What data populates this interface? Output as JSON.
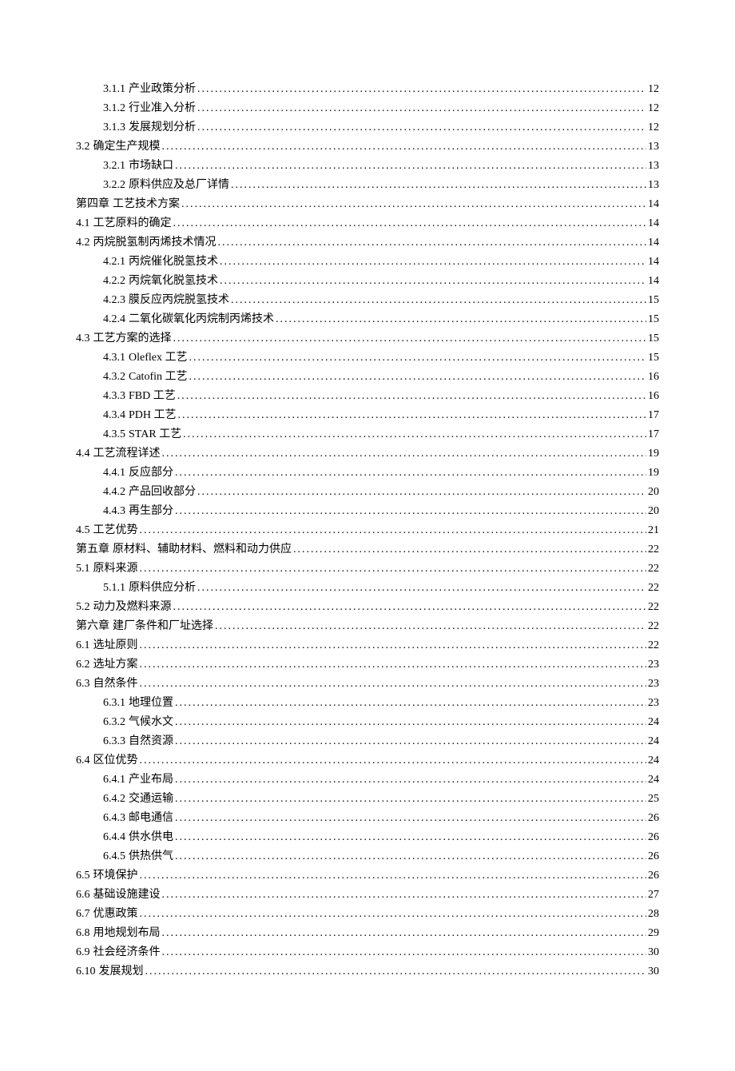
{
  "toc": [
    {
      "level": 3,
      "number": "3.1.1",
      "title": "产业政策分析",
      "page": "12"
    },
    {
      "level": 3,
      "number": "3.1.2",
      "title": "行业准入分析",
      "page": "12"
    },
    {
      "level": 3,
      "number": "3.1.3",
      "title": "发展规划分析",
      "page": "12"
    },
    {
      "level": 1,
      "number": "3.2",
      "title": "确定生产规模",
      "page": "13"
    },
    {
      "level": 2,
      "number": "3.2.1",
      "title": "市场缺口",
      "page": "13"
    },
    {
      "level": 2,
      "number": "3.2.2",
      "title": "原料供应及总厂详情",
      "page": "13"
    },
    {
      "level": 1,
      "number": "第四章",
      "title": "工艺技术方案",
      "page": "14"
    },
    {
      "level": 1,
      "number": "4.1",
      "title": "工艺原料的确定",
      "page": "14"
    },
    {
      "level": 1,
      "number": "4.2",
      "title": "丙烷脱氢制丙烯技术情况",
      "page": "14"
    },
    {
      "level": 3,
      "number": "4.2.1",
      "title": "丙烷催化脱氢技术",
      "page": "14"
    },
    {
      "level": 3,
      "number": "4.2.2",
      "title": "丙烷氧化脱氢技术",
      "page": "14"
    },
    {
      "level": 2,
      "number": "4.2.3",
      "title": "膜反应丙烷脱氢技术",
      "page": "15"
    },
    {
      "level": 2,
      "number": "4.2.4",
      "title": "二氧化碳氧化丙烷制丙烯技术",
      "page": "15"
    },
    {
      "level": 1,
      "number": "4.3",
      "title": "工艺方案的选择",
      "page": "15"
    },
    {
      "level": 2,
      "number": "4.3.1",
      "title": "Oleflex 工艺",
      "page": "15"
    },
    {
      "level": 2,
      "number": "4.3.2",
      "title": "Catofin 工艺",
      "page": "16"
    },
    {
      "level": 2,
      "number": "4.3.3",
      "title": "FBD 工艺",
      "page": "16"
    },
    {
      "level": 2,
      "number": "4.3.4",
      "title": "PDH 工艺",
      "page": "17"
    },
    {
      "level": 2,
      "number": "4.3.5",
      "title": "STAR 工艺",
      "page": "17"
    },
    {
      "level": 1,
      "number": "4.4",
      "title": "工艺流程详述",
      "page": "19"
    },
    {
      "level": 3,
      "number": "4.4.1",
      "title": "反应部分",
      "page": "19"
    },
    {
      "level": 3,
      "number": "4.4.2",
      "title": "产品回收部分",
      "page": "20"
    },
    {
      "level": 3,
      "number": "4.4.3",
      "title": "再生部分",
      "page": "20"
    },
    {
      "level": 1,
      "number": "4.5",
      "title": "工艺优势",
      "page": "21"
    },
    {
      "level": 1,
      "number": "第五章",
      "title": "原材料、辅助材料、燃料和动力供应",
      "page": "22"
    },
    {
      "level": 1,
      "number": "5.1",
      "title": "原料来源",
      "page": "22"
    },
    {
      "level": 2,
      "number": "5.1.1",
      "title": "原料供应分析",
      "page": "22"
    },
    {
      "level": 1,
      "number": "5.2",
      "title": "动力及燃料来源",
      "page": "22"
    },
    {
      "level": 1,
      "number": "第六章",
      "title": "建厂条件和厂址选择",
      "page": "22"
    },
    {
      "level": 1,
      "number": "6.1",
      "title": "选址原则",
      "page": "22"
    },
    {
      "level": 1,
      "number": "6.2",
      "title": "选址方案",
      "page": "23"
    },
    {
      "level": 1,
      "number": "6.3",
      "title": "自然条件",
      "page": "23"
    },
    {
      "level": 2,
      "number": "6.3.1",
      "title": "地理位置",
      "page": "23"
    },
    {
      "level": 2,
      "number": "6.3.2",
      "title": "气候水文",
      "page": "24"
    },
    {
      "level": 2,
      "number": "6.3.3",
      "title": "自然资源",
      "page": "24"
    },
    {
      "level": 1,
      "number": "6.4",
      "title": "区位优势",
      "page": "24"
    },
    {
      "level": 2,
      "number": "6.4.1",
      "title": "产业布局",
      "page": "24"
    },
    {
      "level": 2,
      "number": "6.4.2",
      "title": "交通运输",
      "page": "25"
    },
    {
      "level": 2,
      "number": "6.4.3",
      "title": "邮电通信",
      "page": "26"
    },
    {
      "level": 2,
      "number": "6.4.4",
      "title": "供水供电",
      "page": "26"
    },
    {
      "level": 2,
      "number": "6.4.5",
      "title": "供热供气",
      "page": "26"
    },
    {
      "level": 1,
      "number": "6.5",
      "title": "环境保护",
      "page": "26"
    },
    {
      "level": 1,
      "number": "6.6",
      "title": "基础设施建设",
      "page": "27"
    },
    {
      "level": 1,
      "number": "6.7",
      "title": "优惠政策",
      "page": "28"
    },
    {
      "level": 1,
      "number": "6.8",
      "title": "用地规划布局",
      "page": "29"
    },
    {
      "level": 1,
      "number": "6.9",
      "title": "社会经济条件",
      "page": "30"
    },
    {
      "level": 1,
      "number": "6.10",
      "title": "发展规划",
      "page": "30"
    }
  ]
}
